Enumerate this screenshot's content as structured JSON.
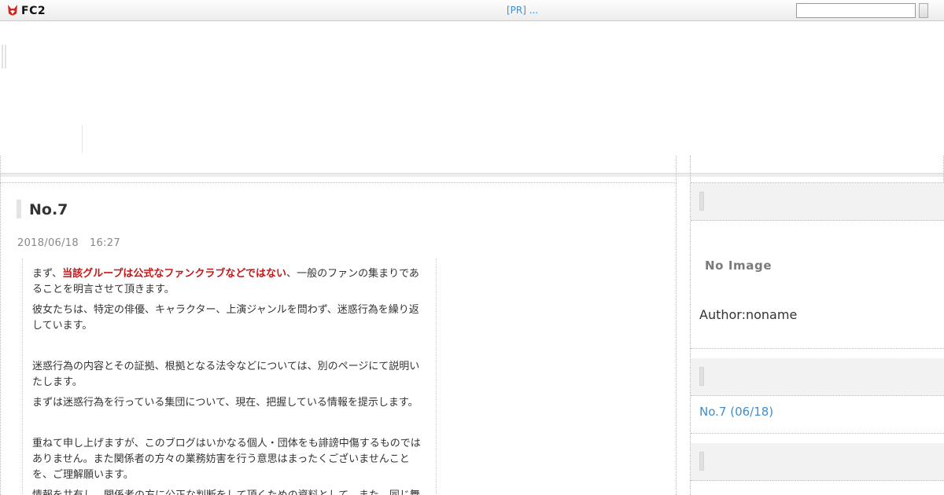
{
  "topbar": {
    "logo_text": "FC2",
    "pr_link": "[PR] ...",
    "search_value": ""
  },
  "entry": {
    "title": "No.7",
    "date": "2018/06/18",
    "time": "16:27",
    "p1_before": "まず、",
    "p1_emphasis": "当該グループは公式なファンクラブなどではない",
    "p1_after": "、一般のファンの集まりであることを明言させて頂きます。",
    "p2": "彼女たちは、特定の俳優、キャラクター、上演ジャンルを問わず、迷惑行為を繰り返しています。",
    "p3": "迷惑行為の内容とその証拠、根拠となる法令などについては、別のページにて説明いたします。",
    "p4": "まずは迷惑行為を行っている集団について、現在、把握している情報を提示します。",
    "p5": "重ねて申し上げますが、このブログはいかなる個人・団体をも誹謗中傷するものではありません。また関係者の方々の業務妨害を行う意思はまったくございませんことを、ご理解願います。",
    "p6": "情報を共有し、関係者の方に公正な判断をして頂くための資料として。また、同じ舞"
  },
  "sidebar": {
    "profile": {
      "no_image": "No Image",
      "author": "Author:noname"
    },
    "recent": {
      "item": "No.7 (06/18)"
    }
  },
  "colors": {
    "link": "#3d8fd1",
    "emphasis": "#cc1414"
  }
}
